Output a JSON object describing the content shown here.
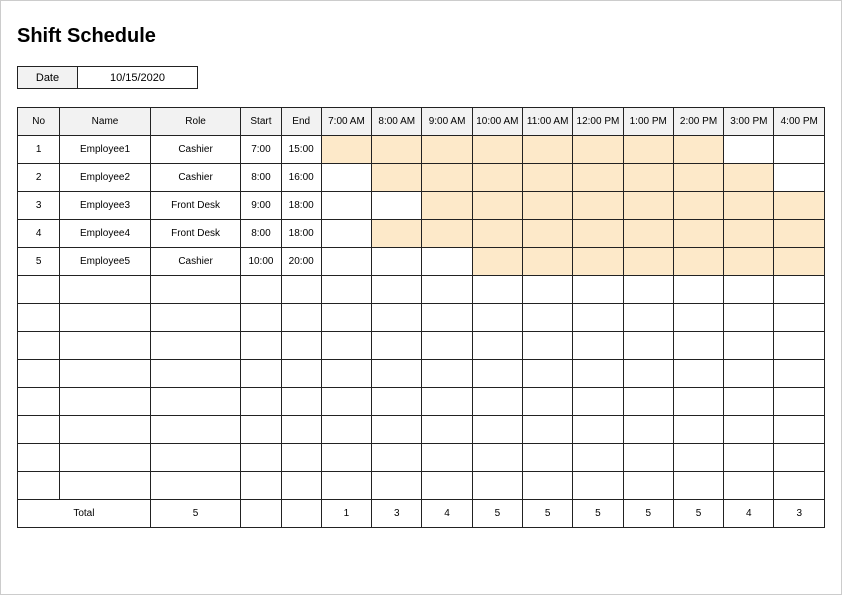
{
  "title": "Shift Schedule",
  "date_label": "Date",
  "date_value": "10/15/2020",
  "headers": {
    "no": "No",
    "name": "Name",
    "role": "Role",
    "start": "Start",
    "end": "End"
  },
  "hours": [
    "7:00 AM",
    "8:00 AM",
    "9:00 AM",
    "10:00 AM",
    "11:00 AM",
    "12:00 PM",
    "1:00 PM",
    "2:00 PM",
    "3:00 PM",
    "4:00 PM"
  ],
  "rows": [
    {
      "no": "1",
      "name": "Employee1",
      "role": "Cashier",
      "start": "7:00",
      "end": "15:00",
      "fill": [
        1,
        1,
        1,
        1,
        1,
        1,
        1,
        1,
        0,
        0
      ]
    },
    {
      "no": "2",
      "name": "Employee2",
      "role": "Cashier",
      "start": "8:00",
      "end": "16:00",
      "fill": [
        0,
        1,
        1,
        1,
        1,
        1,
        1,
        1,
        1,
        0
      ]
    },
    {
      "no": "3",
      "name": "Employee3",
      "role": "Front Desk",
      "start": "9:00",
      "end": "18:00",
      "fill": [
        0,
        0,
        1,
        1,
        1,
        1,
        1,
        1,
        1,
        1
      ]
    },
    {
      "no": "4",
      "name": "Employee4",
      "role": "Front Desk",
      "start": "8:00",
      "end": "18:00",
      "fill": [
        0,
        1,
        1,
        1,
        1,
        1,
        1,
        1,
        1,
        1
      ]
    },
    {
      "no": "5",
      "name": "Employee5",
      "role": "Cashier",
      "start": "10:00",
      "end": "20:00",
      "fill": [
        0,
        0,
        0,
        1,
        1,
        1,
        1,
        1,
        1,
        1
      ]
    }
  ],
  "empty_rows": 8,
  "total": {
    "label": "Total",
    "role_count": "5",
    "hour_counts": [
      "1",
      "3",
      "4",
      "5",
      "5",
      "5",
      "5",
      "5",
      "4",
      "3"
    ]
  }
}
